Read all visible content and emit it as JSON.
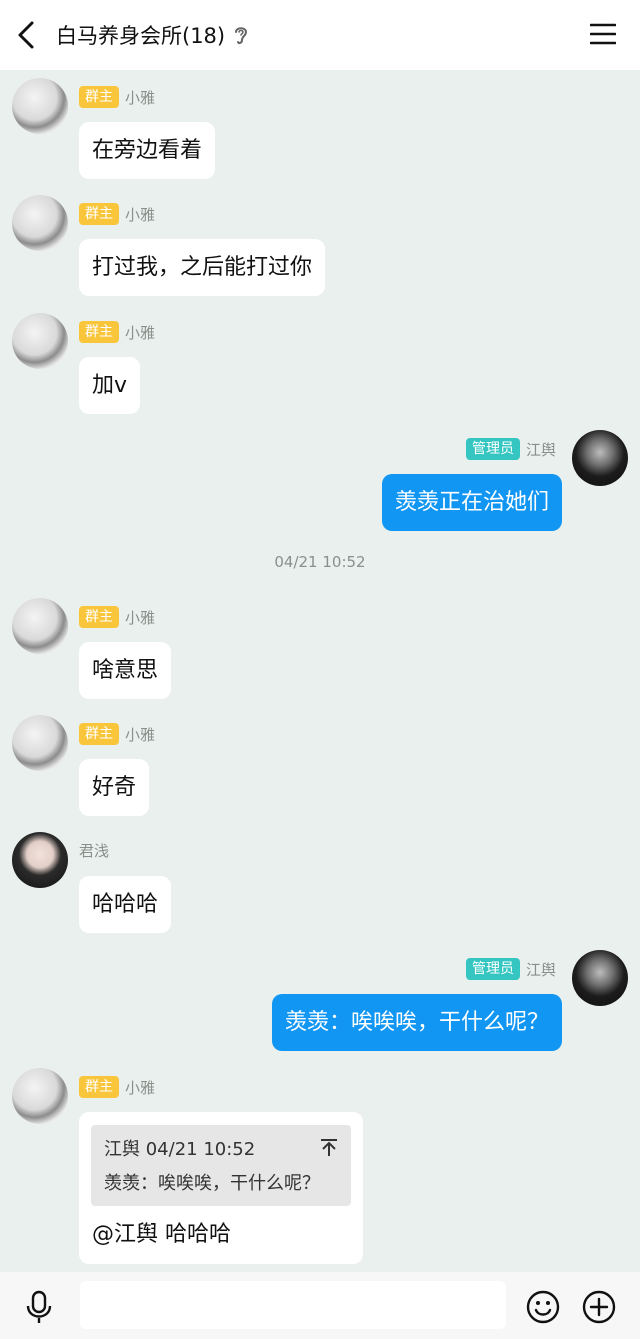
{
  "header": {
    "title": "白马养身会所(18)",
    "back_icon": "chevron-left-icon",
    "ear_icon": "ear-icon",
    "menu_icon": "hamburger-menu-icon"
  },
  "badges": {
    "owner": "群主",
    "admin": "管理员"
  },
  "messages": [
    {
      "sender": "小雅",
      "role": "owner",
      "side": "left",
      "text": "在旁边看着"
    },
    {
      "sender": "小雅",
      "role": "owner",
      "side": "left",
      "text": "打过我，之后能打过你"
    },
    {
      "sender": "小雅",
      "role": "owner",
      "side": "left",
      "text": "加v"
    },
    {
      "sender": "江舆",
      "role": "admin",
      "side": "right",
      "text": "羡羡正在治她们"
    },
    {
      "timestamp": "04/21 10:52"
    },
    {
      "sender": "小雅",
      "role": "owner",
      "side": "left",
      "text": "啥意思"
    },
    {
      "sender": "小雅",
      "role": "owner",
      "side": "left",
      "text": "好奇"
    },
    {
      "sender": "君浅",
      "role": "",
      "side": "left",
      "text": "哈哈哈"
    },
    {
      "sender": "江舆",
      "role": "admin",
      "side": "right",
      "text": "羡羡：唉唉唉，干什么呢？"
    },
    {
      "sender": "小雅",
      "role": "owner",
      "side": "left",
      "quote": {
        "author": "江舆",
        "time": "04/21 10:52",
        "text": "羡羡：唉唉唉，干什么呢？"
      },
      "text": "@江舆 哈哈哈"
    }
  ],
  "input": {
    "placeholder": "",
    "value": ""
  },
  "bottom": {
    "mic_icon": "microphone-icon",
    "emoji_icon": "smiley-icon",
    "plus_icon": "plus-circle-icon"
  },
  "colors": {
    "background": "#eaf0ed",
    "outgoing_bubble": "#1296f3",
    "owner_badge": "#f9c53b",
    "admin_badge": "#35c6c2"
  }
}
